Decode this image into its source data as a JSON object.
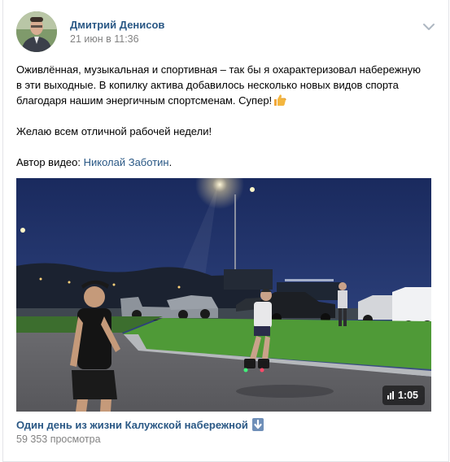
{
  "post": {
    "author": "Дмитрий Денисов",
    "date": "21 июн в 11:36",
    "text_line1": "Оживлённая, музыкальная и спортивная – так бы я охарактеризовал набережную",
    "text_line2": "в эти выходные. В копилку актива добавилось несколько новых видов спорта",
    "text_line3": "благодаря нашим энергичным спортсменам. Супер!",
    "text_wish": "Желаю всем отличной рабочей недели!",
    "video_author_prefix": "Автор видео: ",
    "video_author_name": "Николай Заботин",
    "video_author_suffix": ".",
    "emoji": "thumbs-up-emoji"
  },
  "video": {
    "duration": "1:05",
    "title": "Один день из жизни Калужской набережной",
    "views": "59 353 просмотра"
  },
  "colors": {
    "link": "#2a5885",
    "meta": "#828282",
    "emoji": "#f4b63f"
  }
}
